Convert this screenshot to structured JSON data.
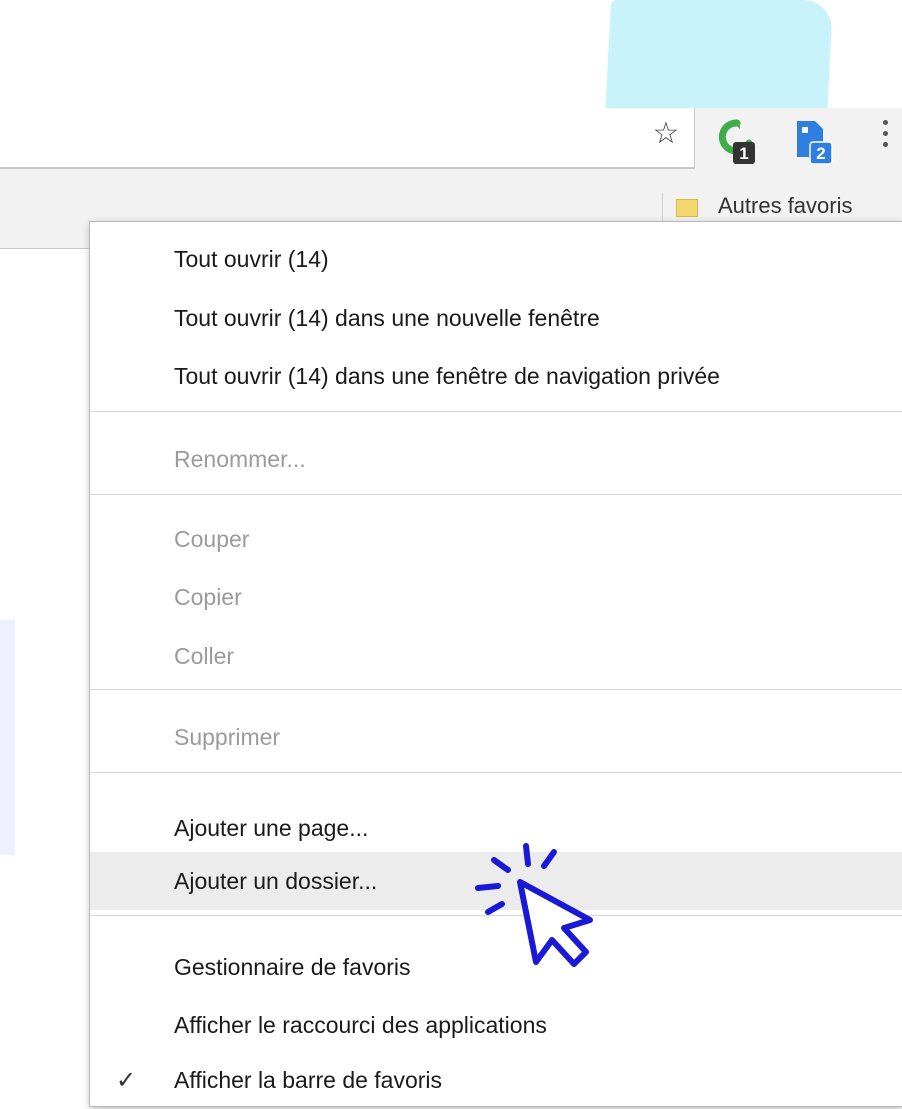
{
  "toolbar": {
    "star_glyph": "☆",
    "ext1_badge": "1",
    "ext2_badge": "2",
    "menu_icon": "kebab-menu-icon"
  },
  "bookmarks_bar": {
    "other_bookmarks_label": "Autres favoris"
  },
  "context_menu": {
    "open_all": "Tout ouvrir (14)",
    "open_all_new_window": "Tout ouvrir (14) dans une nouvelle fenêtre",
    "open_all_incognito": "Tout ouvrir (14) dans une fenêtre de navigation privée",
    "rename": "Renommer...",
    "cut": "Couper",
    "copy": "Copier",
    "paste": "Coller",
    "delete": "Supprimer",
    "add_page": "Ajouter une page...",
    "add_folder": "Ajouter un dossier...",
    "bookmark_manager": "Gestionnaire de favoris",
    "show_apps_shortcut": "Afficher le raccourci des applications",
    "show_bookmarks_bar": "Afficher la barre de favoris",
    "check_glyph": "✓"
  },
  "colors": {
    "cursor_blue": "#1a1ad6",
    "menu_highlight": "#ececec",
    "disabled_text": "#9b9b9b",
    "ext1_green": "#3fae4a",
    "ext2_blue": "#2f7fe0"
  }
}
